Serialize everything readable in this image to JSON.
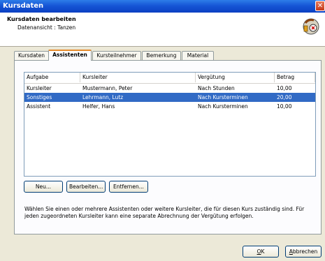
{
  "window": {
    "title": "Kursdaten",
    "close_label": "✕"
  },
  "header": {
    "title": "Kursdaten bearbeiten",
    "subtitle": "Datenansicht : Tanzen"
  },
  "tabs": [
    {
      "label": "Kursdaten"
    },
    {
      "label": "Assistenten"
    },
    {
      "label": "Kursteilnehmer"
    },
    {
      "label": "Bemerkung"
    },
    {
      "label": "Material"
    }
  ],
  "active_tab": "Assistenten",
  "table": {
    "columns": [
      "Aufgabe",
      "Kursleiter",
      "Vergütung",
      "Betrag"
    ],
    "rows": [
      {
        "aufgabe": "Kursleiter",
        "kursleiter": "Mustermann, Peter",
        "verguetung": "Nach Stunden",
        "betrag": "10,00",
        "selected": false
      },
      {
        "aufgabe": "Sonstiges",
        "kursleiter": "Lehrmann, Lutz",
        "verguetung": "Nach Kursterminen",
        "betrag": "20,00",
        "selected": true
      },
      {
        "aufgabe": "Assistent",
        "kursleiter": "Helfer, Hans",
        "verguetung": "Nach Kursterminen",
        "betrag": "10,00",
        "selected": false
      }
    ]
  },
  "buttons": {
    "new": "Neu...",
    "edit": "Bearbeiten...",
    "remove": "Entfernen..."
  },
  "info_text": "Wählen Sie einen oder mehrere Assistenten oder weitere Kursleiter, die für diesen Kurs zuständig sind. Für jeden zugeordneten Kursleiter kann eine separate Abrechnung der Vergütung erfolgen.",
  "footer": {
    "ok_underline": "O",
    "ok_rest": "K",
    "cancel_underline": "A",
    "cancel_rest": "bbrechen"
  },
  "icons": {
    "logo": "tools-sphere-icon",
    "close": "close-icon"
  },
  "colors": {
    "selection": "#316ac5",
    "titlebar": "#0b3fc2",
    "tab_accent": "#e68b2c"
  }
}
